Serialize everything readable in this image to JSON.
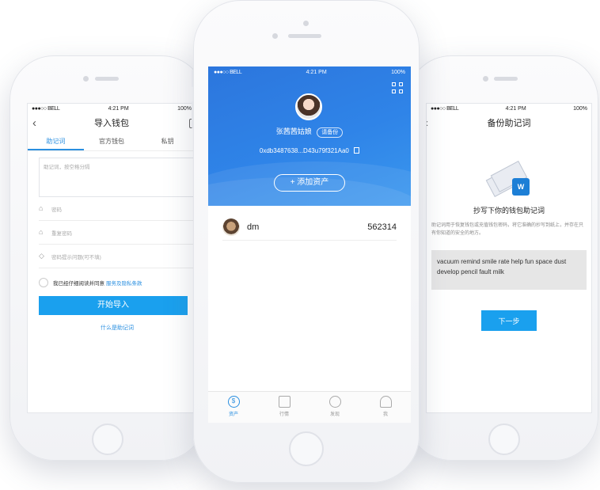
{
  "left_phone": {
    "status": {
      "carrier": "●●●○○ BELL",
      "time": "4:21 PM",
      "battery": "100%"
    },
    "nav_title": "导入钱包",
    "tabs": [
      {
        "label": "助记词",
        "active": true
      },
      {
        "label": "官方钱包",
        "active": false
      },
      {
        "label": "私钥",
        "active": false
      }
    ],
    "mnemonic_placeholder": "助记词，按空格分隔",
    "password_placeholder": "密码",
    "repeat_password_placeholder": "重复密码",
    "hint_placeholder": "密码提示问题(可不填)",
    "agree_text": "我已经仔细阅读并同意",
    "agree_link": "服务及隐私条款",
    "start_import_label": "开始导入",
    "what_is_mnemonic": "什么是助记词"
  },
  "center_phone": {
    "status": {
      "carrier": "●●●○○ BELL",
      "time": "4:21 PM",
      "battery": "100%"
    },
    "username": "张茜茜姑娘",
    "backup_tag": "请备份",
    "address": "0xdb3487638...D43u79f321Aa0",
    "add_asset_label": "+ 添加资产",
    "assets": [
      {
        "name": "dm",
        "balance": "562314"
      }
    ],
    "tabbar": [
      {
        "label": "资产",
        "active": true,
        "icon": "dollar-icon"
      },
      {
        "label": "行情",
        "active": false,
        "icon": "wallet-icon"
      },
      {
        "label": "发现",
        "active": false,
        "icon": "discover-icon"
      },
      {
        "label": "我",
        "active": false,
        "icon": "user-icon"
      }
    ]
  },
  "right_phone": {
    "status": {
      "carrier": "●●●○○ BELL",
      "time": "4:21 PM",
      "battery": "100%"
    },
    "nav_title": "备份助记词",
    "title": "抄写下你的钱包助记词",
    "desc": "助记词用于恢复钱包或充值钱包密码，将它准确的抄写到纸上，并存在只有你知道的安全的地方。",
    "mnemonic_words": "vacuum remind smile rate help fun space dust develop pencil fault milk",
    "next_label": "下一步"
  },
  "colors": {
    "accent": "#1aa0ee",
    "hero_blue": "#2f84e8"
  }
}
